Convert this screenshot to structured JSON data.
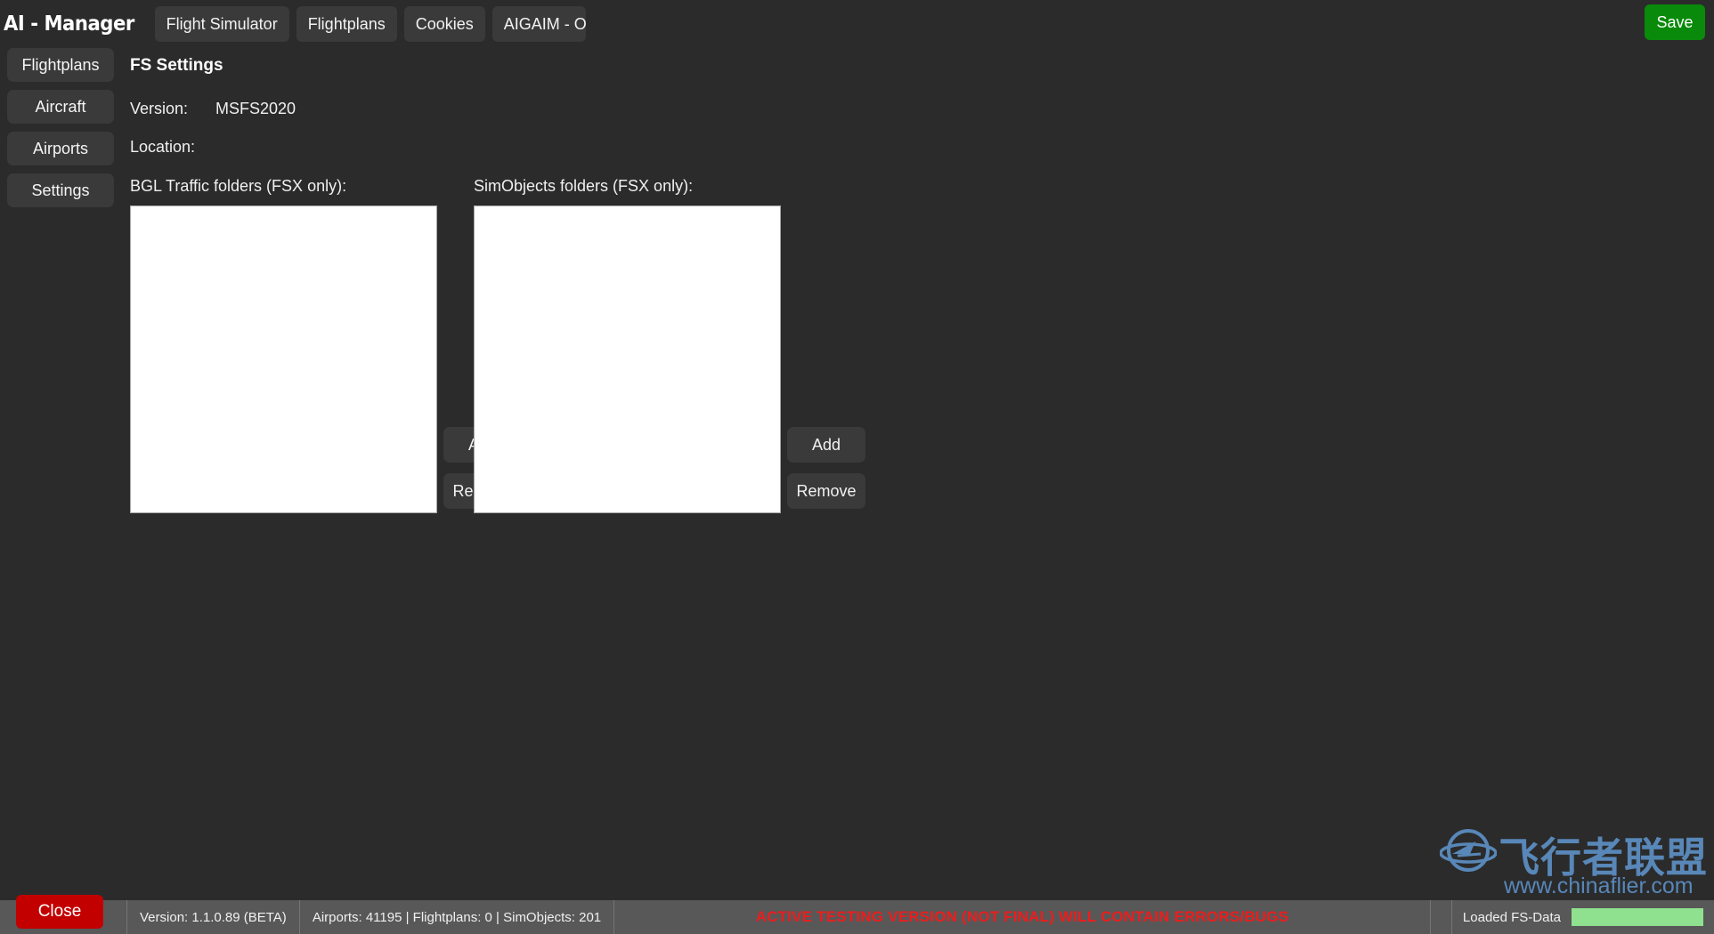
{
  "app": {
    "logo": "AI - Manager"
  },
  "topbar": {
    "tabs": [
      {
        "label": "Flight Simulator",
        "active": true
      },
      {
        "label": "Flightplans",
        "active": false
      },
      {
        "label": "Cookies",
        "active": false
      },
      {
        "label": "AIGAIM - OCI",
        "active": false
      }
    ],
    "save_label": "Save"
  },
  "sidebar": {
    "items": [
      {
        "label": "Flightplans"
      },
      {
        "label": "Aircraft"
      },
      {
        "label": "Airports"
      },
      {
        "label": "Settings"
      }
    ]
  },
  "main": {
    "title": "FS Settings",
    "version_label": "Version:",
    "version_value": "MSFS2020",
    "location_label": "Location:",
    "location_value": "",
    "lists": [
      {
        "label": "BGL Traffic folders (FSX only):",
        "items": [],
        "add_label": "Add",
        "remove_label": "Remove"
      },
      {
        "label": "SimObjects folders (FSX only):",
        "items": [],
        "add_label": "Add",
        "remove_label": "Remove"
      }
    ]
  },
  "watermark": {
    "text_cn": "飞行者联盟",
    "url": "www.chinaflier.com",
    "color": "#5b8cc0"
  },
  "statusbar": {
    "close_label": "Close",
    "version": "Version: 1.1.0.89 (BETA)",
    "counts": "Airports: 41195 | Flightplans: 0 | SimObjects: 201",
    "warning": "ACTIVE TESTING VERSION (NOT FINAL) WILL CONTAIN ERRORS/BUGS",
    "loaded_label": "Loaded FS-Data",
    "progress_percent": 100
  },
  "colors": {
    "background": "#2b2b2b",
    "button": "#3a3a3a",
    "save_green": "#0a8a0a",
    "close_red": "#c20000",
    "warning_red": "#ee1c1c",
    "progress_green": "#8fe08f",
    "statusbar": "#585858"
  }
}
